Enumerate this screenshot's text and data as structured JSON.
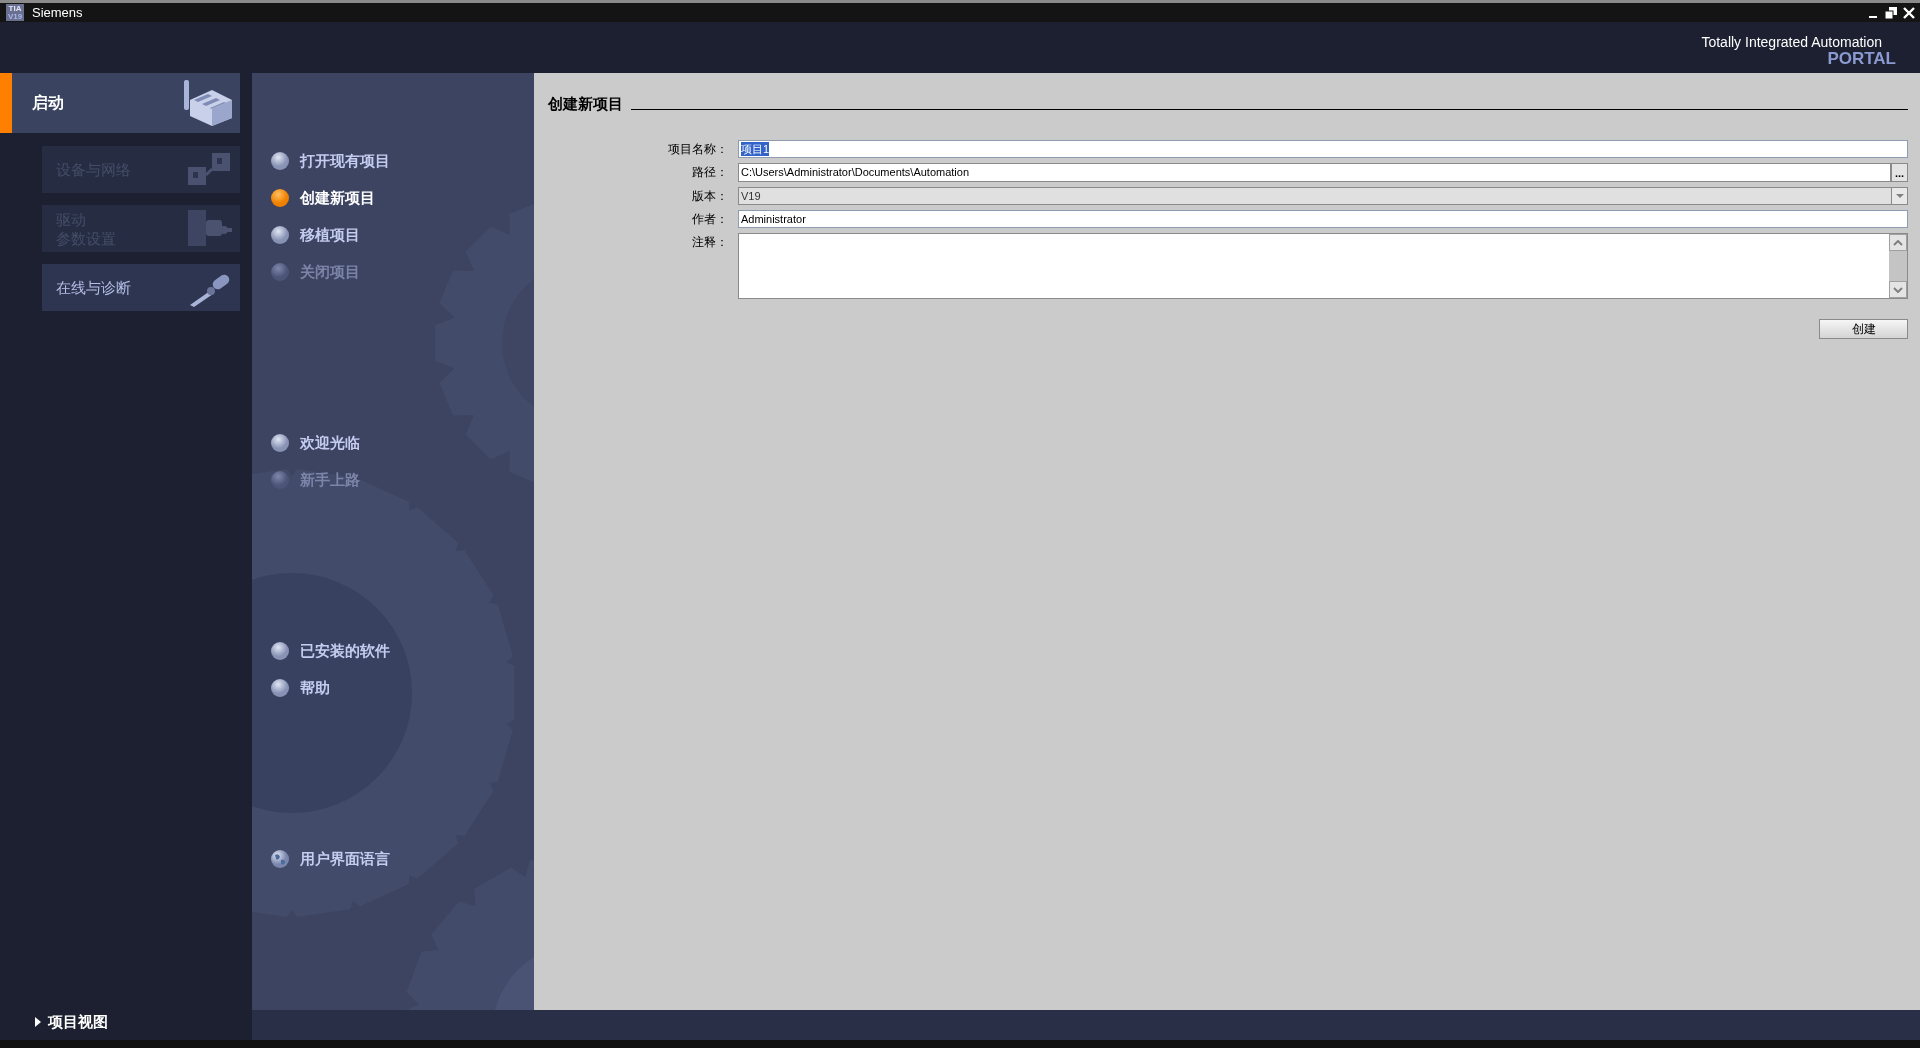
{
  "window": {
    "title": "Siemens",
    "logo_lines": [
      "TIA",
      "V19"
    ]
  },
  "header": {
    "brand": "Totally Integrated Automation",
    "product": "PORTAL"
  },
  "start_portal": {
    "label": "启动",
    "selected": true
  },
  "portals": [
    {
      "lines": [
        "设备与网络"
      ],
      "kind": "network",
      "disabled": true
    },
    {
      "lines": [
        "驱动",
        "参数设置"
      ],
      "kind": "drive",
      "disabled": true
    },
    {
      "lines": [
        "在线与诊断"
      ],
      "kind": "diagnostics",
      "disabled": false
    }
  ],
  "action_groups": [
    [
      {
        "label": "打开现有项目",
        "kind": "bullet",
        "selected": false,
        "disabled": false
      },
      {
        "label": "创建新项目",
        "kind": "bullet",
        "selected": true,
        "disabled": false
      },
      {
        "label": "移植项目",
        "kind": "bullet",
        "selected": false,
        "disabled": false
      },
      {
        "label": "关闭项目",
        "kind": "bullet",
        "selected": false,
        "disabled": true
      }
    ],
    [
      {
        "label": "欢迎光临",
        "kind": "bullet",
        "selected": false,
        "disabled": false
      },
      {
        "label": "新手上路",
        "kind": "bullet",
        "selected": false,
        "disabled": true
      }
    ],
    [
      {
        "label": "已安装的软件",
        "kind": "bullet",
        "selected": false,
        "disabled": false
      },
      {
        "label": "帮助",
        "kind": "bullet",
        "selected": false,
        "disabled": false
      }
    ],
    [
      {
        "label": "用户界面语言",
        "kind": "globe",
        "selected": false,
        "disabled": false
      }
    ]
  ],
  "form": {
    "title": "创建新项目",
    "fields": [
      {
        "label": "项目名称：",
        "kind": "text",
        "value": "项目1",
        "text_selected": true
      },
      {
        "label": "路径：",
        "kind": "path",
        "value": "C:\\Users\\Administrator\\Documents\\Automation",
        "browse": "..."
      },
      {
        "label": "版本：",
        "kind": "dropdown",
        "value": "V19"
      },
      {
        "label": "作者：",
        "kind": "text",
        "value": "Administrator",
        "text_selected": false
      },
      {
        "label": "注释：",
        "kind": "textarea"
      }
    ],
    "button": "创建"
  },
  "footer": {
    "link": "项目视图"
  }
}
